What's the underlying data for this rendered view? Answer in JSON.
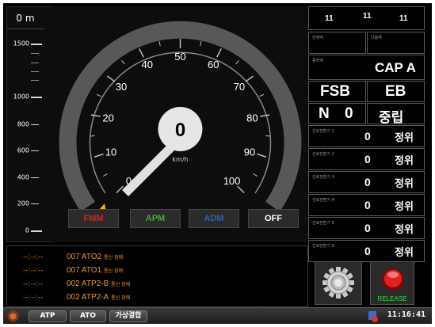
{
  "ruler": {
    "top_label": "0 m",
    "marks": [
      {
        "label": "1500",
        "major": true
      },
      {
        "label": "1000",
        "major": true
      },
      {
        "label": "800",
        "major": false
      },
      {
        "label": "600",
        "major": false
      },
      {
        "label": "400",
        "major": false
      },
      {
        "label": "200",
        "major": false
      },
      {
        "label": "0",
        "major": true
      }
    ]
  },
  "speedometer": {
    "current_speed": "0",
    "unit": "km/h",
    "scale_labels": [
      "0",
      "10",
      "20",
      "30",
      "40",
      "50",
      "60",
      "70",
      "80",
      "90",
      "100"
    ]
  },
  "mode_buttons": {
    "fmm": "FMM",
    "apm": "APM",
    "adm": "ADM",
    "off": "OFF"
  },
  "status": {
    "top_numbers": [
      "11",
      "11",
      "11"
    ],
    "current_station_label": "현재역",
    "next_station_label": "다음역",
    "destination_label": "종착역",
    "destination_value": "CAP A",
    "brake_fsb": "FSB",
    "brake_eb": "EB",
    "gear_letter": "N",
    "gear_notch": "0",
    "direction": "중립"
  },
  "switches": [
    {
      "label": "선로전환기 1",
      "value": "0",
      "state": "정위"
    },
    {
      "label": "선로전환기 2",
      "value": "0",
      "state": "정위"
    },
    {
      "label": "선로전환기 3",
      "value": "0",
      "state": "정위"
    },
    {
      "label": "선로전환기 4",
      "value": "0",
      "state": "정위"
    },
    {
      "label": "선로전환기 5",
      "value": "0",
      "state": "정위"
    },
    {
      "label": "선로전환기 6",
      "value": "0",
      "state": "정위"
    }
  ],
  "messages": [
    {
      "time": "--:--:--",
      "code": "007 ATO2",
      "desc": "통신 장애"
    },
    {
      "time": "--:--:--",
      "code": "007 ATO1",
      "desc": "통신 장애"
    },
    {
      "time": "--:--:--",
      "code": "002 ATP2-B",
      "desc": "통신 장애"
    },
    {
      "time": "--:--:--",
      "code": "002 ATP2-A",
      "desc": "통신 장애"
    }
  ],
  "actions": {
    "release_label": "RELEASE"
  },
  "taskbar": {
    "buttons": [
      "ATP",
      "ATO",
      "가상결합"
    ],
    "clock": "11:16:41"
  },
  "colors": {
    "fmm": "#c8281e",
    "apm": "#3fae3a",
    "adm": "#2a62b8",
    "off": "#ffffff",
    "message": "#e09a30",
    "release": "#33dd44",
    "needle": "#e0e0e0",
    "cursor": "#f0b400"
  }
}
